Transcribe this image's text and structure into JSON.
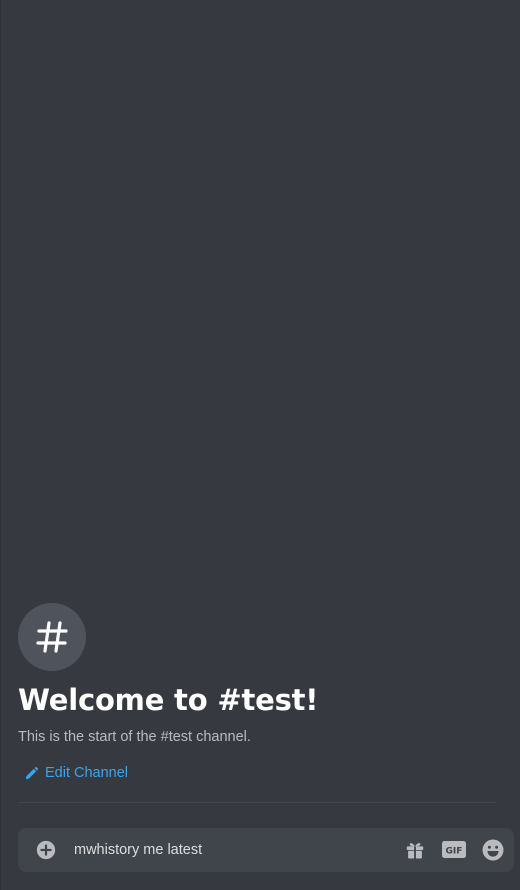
{
  "channel": {
    "avatar_glyph": "#",
    "welcome_title": "Welcome to #test!",
    "welcome_subtitle": "This is the start of the #test channel.",
    "edit_label": "Edit Channel"
  },
  "composer": {
    "message_value": "mwhistory me latest",
    "icons": {
      "attach": "plus-circle-icon",
      "gift": "gift-icon",
      "gif": "gif-icon",
      "emoji": "emoji-icon"
    }
  },
  "colors": {
    "background": "#36393f",
    "composer": "#40444b",
    "link": "#3ca4e8",
    "title": "#ffffff",
    "muted": "#b9bbbe"
  }
}
